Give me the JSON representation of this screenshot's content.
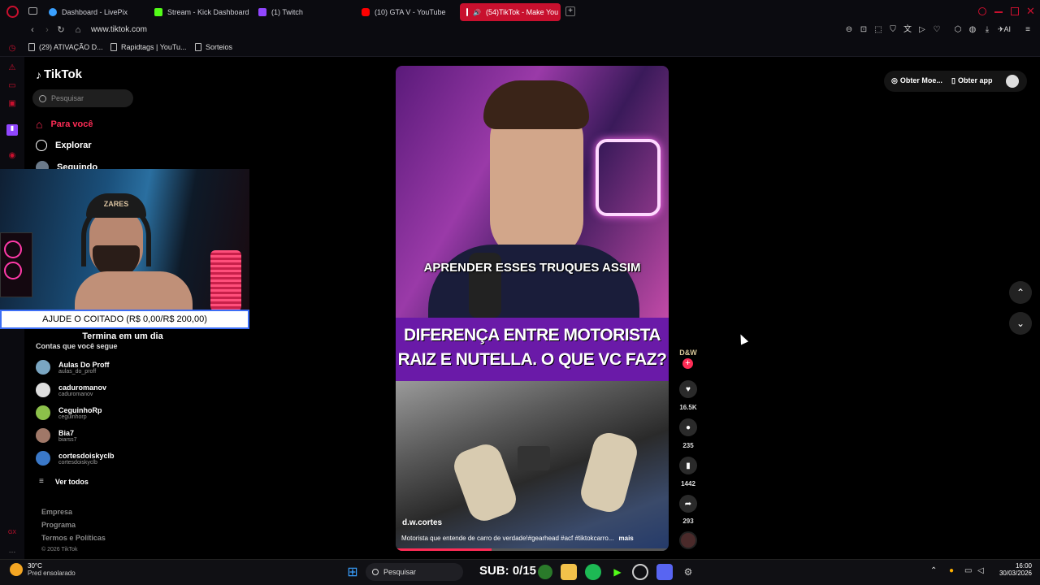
{
  "browser": {
    "tabs": [
      {
        "label": "Dashboard - LivePix"
      },
      {
        "label": "Stream - Kick Dashboard"
      },
      {
        "label": "(1) Twitch"
      },
      {
        "label": "(10) GTA V - YouTube"
      },
      {
        "label": "(54)TikTok - Make You"
      }
    ],
    "url": "www.tiktok.com",
    "bookmarks": [
      {
        "label": "(29) ATIVAÇÃO D..."
      },
      {
        "label": "Rapidtags | YouTu..."
      },
      {
        "label": "Sorteios"
      }
    ],
    "toolbar_ai": "AI"
  },
  "tiktok": {
    "logo": "TikTok",
    "search_placeholder": "Pesquisar",
    "nav": [
      {
        "label": "Para você"
      },
      {
        "label": "Explorar"
      },
      {
        "label": "Seguindo"
      }
    ],
    "following_title": "Contas que você segue",
    "accounts": [
      {
        "name": "Aulas Do Proff",
        "handle": "aulas_do_proff"
      },
      {
        "name": "caduromanov",
        "handle": "caduromanov"
      },
      {
        "name": "CeguinhoRp",
        "handle": "ceguinhorp"
      },
      {
        "name": "Bia7",
        "handle": "biarss7"
      },
      {
        "name": "cortesdoiskyclb",
        "handle": "cortesdoiskyclb"
      }
    ],
    "see_all": "Ver todos",
    "footer": {
      "company": "Empresa",
      "program": "Programa",
      "terms": "Termos e Políticas",
      "copyright": "© 2026 TikTok"
    },
    "top_right": {
      "coins": "Obter Moe...",
      "app": "Obter app"
    },
    "video": {
      "caption_top": "APRENDER ESSES TRUQUES ASSIM",
      "headline_1": "DIFERENÇA ENTRE MOTORISTA",
      "headline_2": "RAIZ E NUTELLA. O QUE VC FAZ?",
      "author": "d.w.cortes",
      "description": "Motorista que entende de carro de verdade!#gearhead #acf #tiktokcarro...",
      "more": "mais",
      "badge": "D&W",
      "likes": "16.5K",
      "comments": "235",
      "saves": "1442",
      "shares": "293"
    }
  },
  "overlay": {
    "goal": "AJUDE O COITADO (R$ 0,00/R$ 200,00)",
    "ends": "Termina em um dia",
    "sub_counter": "SUB: 0/15",
    "cap_text": "ZARES"
  },
  "taskbar": {
    "weather_temp": "30°C",
    "weather_desc": "Pred ensolarado",
    "search": "Pesquisar",
    "time": "16:00",
    "date": "30/03/2026"
  },
  "colors": {
    "accent": "#fe2c55",
    "opera": "#c8102e",
    "purple": "#6a1aa8"
  }
}
